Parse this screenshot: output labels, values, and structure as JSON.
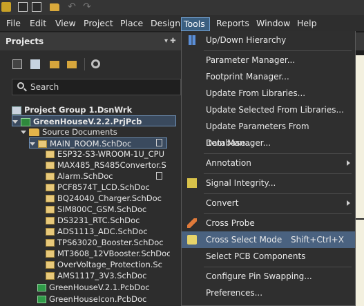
{
  "menubar": {
    "items": [
      "File",
      "Edit",
      "View",
      "Project",
      "Place",
      "Design",
      "Tools",
      "Reports",
      "Window",
      "Help"
    ],
    "active": "Tools"
  },
  "projects_panel": {
    "title": "Projects",
    "search_placeholder": "Search",
    "tree": [
      {
        "label": "Project Group 1.DsnWrk",
        "icon": "project-group-icon"
      },
      {
        "label": "GreenHouseV.2.2.PrjPcb",
        "icon": "pcb-project-icon"
      },
      {
        "label": "Source Documents",
        "icon": "folder-icon"
      },
      {
        "label": "MAIN_ROOM.SchDoc",
        "icon": "schematic-icon"
      },
      {
        "label": "ESP32-S3-WROOM-1U_CPU",
        "icon": "schematic-icon"
      },
      {
        "label": "MAX485_RS485Convertor.S",
        "icon": "schematic-icon"
      },
      {
        "label": "Alarm.SchDoc",
        "icon": "schematic-icon"
      },
      {
        "label": "PCF8574T_LCD.SchDoc",
        "icon": "schematic-icon"
      },
      {
        "label": "BQ24040_Charger.SchDoc",
        "icon": "schematic-icon"
      },
      {
        "label": "SIM800C_GSM.SchDoc",
        "icon": "schematic-icon"
      },
      {
        "label": "DS3231_RTC.SchDoc",
        "icon": "schematic-icon"
      },
      {
        "label": "ADS1113_ADC.SchDoc",
        "icon": "schematic-icon"
      },
      {
        "label": "TPS63020_Booster.SchDoc",
        "icon": "schematic-icon"
      },
      {
        "label": "MT3608_12VBooster.SchDoc",
        "icon": "schematic-icon"
      },
      {
        "label": "OverVoltage_Protection.Sc",
        "icon": "schematic-icon"
      },
      {
        "label": "AMS1117_3V3.SchDoc",
        "icon": "schematic-icon"
      },
      {
        "label": "GreenHouseV.2.1.PcbDoc",
        "icon": "pcb-doc-icon"
      },
      {
        "label": "GreenHouseIcon.PcbDoc",
        "icon": "pcb-doc-icon"
      }
    ]
  },
  "tools_menu": {
    "items": [
      {
        "label": "Up/Down Hierarchy",
        "icon": "hierarchy-icon",
        "shortcut": "",
        "submenu": false
      },
      {
        "label": "Parameter Manager...",
        "icon": "",
        "shortcut": "",
        "submenu": false
      },
      {
        "label": "Footprint Manager...",
        "icon": "",
        "shortcut": "",
        "submenu": false
      },
      {
        "label": "Update From Libraries...",
        "icon": "",
        "shortcut": "",
        "submenu": false
      },
      {
        "label": "Update Selected From Libraries...",
        "icon": "",
        "shortcut": "",
        "submenu": false
      },
      {
        "label": "Update Parameters From Database...",
        "icon": "",
        "shortcut": "",
        "submenu": false
      },
      {
        "label": "Item Manager...",
        "icon": "",
        "shortcut": "",
        "submenu": false
      },
      {
        "label": "Annotation",
        "icon": "",
        "shortcut": "",
        "submenu": true
      },
      {
        "label": "Signal Integrity...",
        "icon": "signal-integrity-icon",
        "shortcut": "",
        "submenu": false
      },
      {
        "label": "Convert",
        "icon": "",
        "shortcut": "",
        "submenu": true
      },
      {
        "label": "Cross Probe",
        "icon": "cross-probe-icon",
        "shortcut": "",
        "submenu": false
      },
      {
        "label": "Cross Select Mode",
        "icon": "cross-select-icon",
        "shortcut": "Shift+Ctrl+X",
        "submenu": false,
        "highlighted": true
      },
      {
        "label": "Select PCB Components",
        "icon": "",
        "shortcut": "",
        "submenu": false
      },
      {
        "label": "Configure Pin Swapping...",
        "icon": "",
        "shortcut": "",
        "submenu": false
      },
      {
        "label": "Preferences...",
        "icon": "",
        "shortcut": "",
        "submenu": false
      }
    ]
  }
}
